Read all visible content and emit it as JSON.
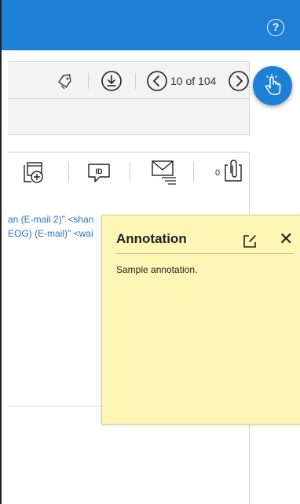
{
  "header": {
    "help_label": "?",
    "help_icon": "question-circle-icon",
    "color": "#1e7fd6"
  },
  "toolbar": {
    "tag_icon": "tag-icon",
    "download_icon": "download-icon",
    "prev_icon": "chevron-left-icon",
    "next_icon": "chevron-right-icon",
    "page_indicator": "10 of 104"
  },
  "touch_button": {
    "icon": "touch-hand-icon"
  },
  "actions": {
    "add_item_icon": "add-document-icon",
    "id_icon": "id-card-icon",
    "mail_icon": "mail-list-icon",
    "attachment_icon": "attachment-clip-icon",
    "attachment_count": "0"
  },
  "email": {
    "line1": "an (E-mail 2)\" <shan",
    "line2": "EOG) (E-mail)\" <wai"
  },
  "annotation": {
    "title": "Annotation",
    "body": "Sample annotation.",
    "edit_icon": "edit-icon",
    "close_label": "✕",
    "background": "#fdf6b4"
  }
}
